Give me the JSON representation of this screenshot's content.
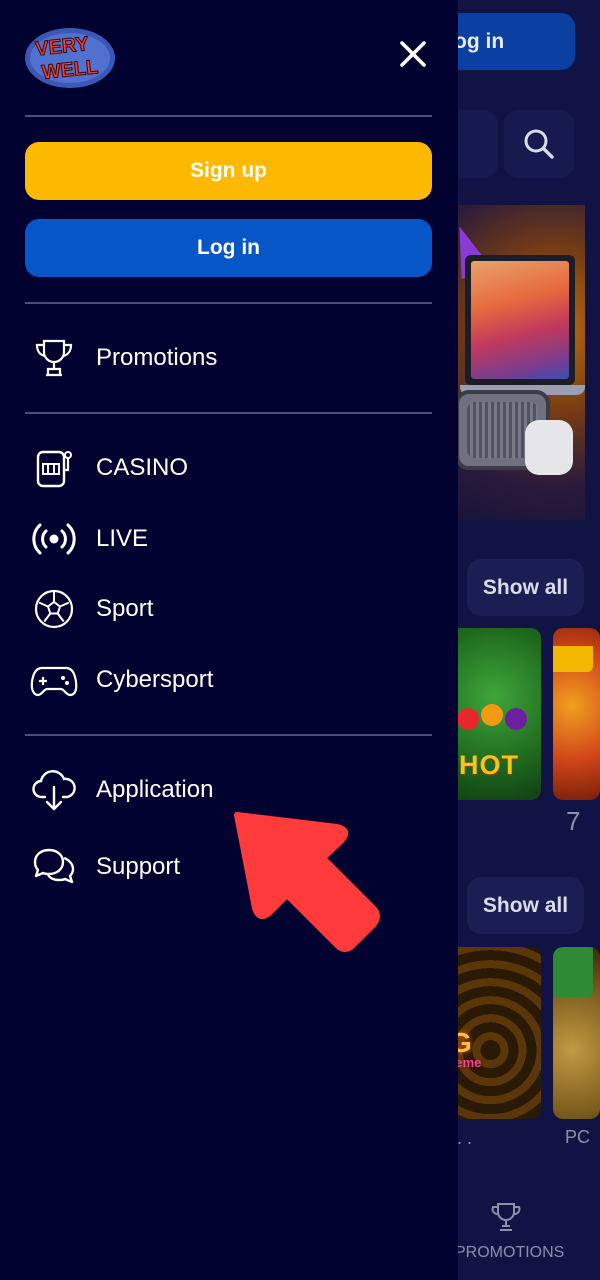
{
  "background_page": {
    "login_button_partial": "og in",
    "show_all_1": "Show all",
    "show_all_2": "Show all",
    "game_a_text": "HOT",
    "game_c_text": "G",
    "game_c_sub": "treme",
    "partial_7": "7",
    "partial_dots": ". .",
    "partial_po": "PC",
    "bottom_nav_promotions": "PROMOTIONS"
  },
  "drawer": {
    "logo_text": "VERY WELL",
    "signup_label": "Sign up",
    "login_label": "Log in",
    "menu": {
      "promotions": "Promotions",
      "casino": "CASINO",
      "live": "LIVE",
      "sport": "Sport",
      "cybersport": "Cybersport",
      "application": "Application",
      "support": "Support"
    }
  },
  "colors": {
    "drawer_bg": "#020231",
    "signup": "#fdb900",
    "login": "#0656c8",
    "arrow": "#ff3b3b"
  },
  "icons": [
    "close-icon",
    "trophy-icon",
    "slot-machine-icon",
    "live-broadcast-icon",
    "soccer-ball-icon",
    "gamepad-icon",
    "cloud-download-icon",
    "chat-bubbles-icon",
    "search-icon"
  ]
}
